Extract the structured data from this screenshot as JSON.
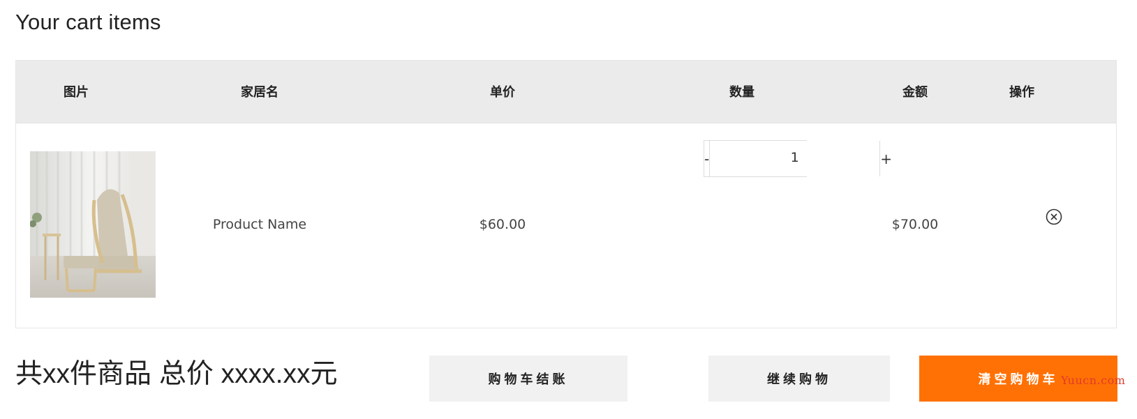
{
  "page": {
    "title": "Your cart items"
  },
  "table": {
    "headers": {
      "image": "图片",
      "name": "家居名",
      "unit_price": "单价",
      "quantity": "数量",
      "amount": "金额",
      "action": "操作"
    },
    "rows": [
      {
        "image_icon": "armchair-photo",
        "name": "Product Name",
        "unit_price": "$60.00",
        "quantity": "1",
        "decrement_label": "-",
        "increment_label": "+",
        "amount": "$70.00",
        "remove_icon": "circle-x-icon"
      }
    ]
  },
  "summary": {
    "text": "共xx件商品 总价 xxxx.xx元"
  },
  "actions": {
    "checkout_label": "购物车结账",
    "continue_label": "继续购物",
    "clear_label": "清空购物车"
  },
  "watermark": {
    "text": "Yuucn.com"
  },
  "colors": {
    "header_bg": "#ebebeb",
    "button_bg": "#f1f1f1",
    "accent_orange": "#ff7104",
    "watermark_red": "#e23a2b"
  }
}
